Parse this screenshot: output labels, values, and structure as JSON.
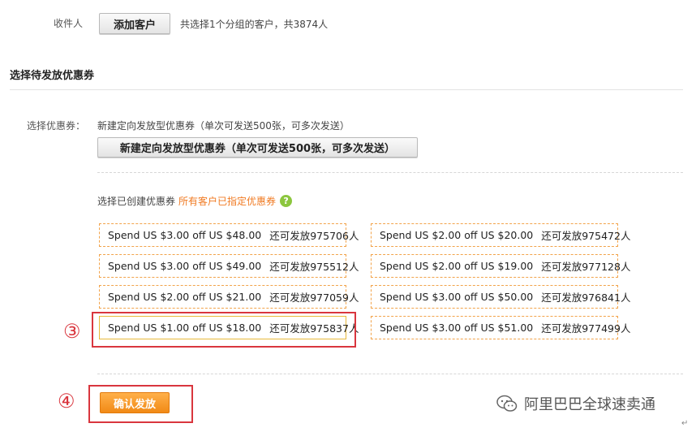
{
  "recipient": {
    "label": "收件人",
    "add_button": "添加客户",
    "summary": "共选择1个分组的客户，共3874人"
  },
  "section_title": "选择待发放优惠券",
  "coupon_select": {
    "label": "选择优惠券：",
    "new_description": "新建定向发放型优惠券（单次可发送500张，可多次发送）",
    "new_button": "新建定向发放型优惠券（单次可发送500张，可多次发送）",
    "existing_label": "选择已创建优惠券",
    "existing_link": "所有客户已指定优惠券",
    "help_glyph": "?"
  },
  "coupons_left": [
    {
      "text": "Spend US $3.00 off US $48.00",
      "remain": "还可发放975706人"
    },
    {
      "text": "Spend US $3.00 off US $49.00",
      "remain": "还可发放975512人"
    },
    {
      "text": "Spend US $2.00 off US $21.00",
      "remain": "还可发放977059人"
    },
    {
      "text": "Spend US $1.00 off US $18.00",
      "remain": "还可发放975837人"
    }
  ],
  "coupons_right": [
    {
      "text": "Spend US $2.00 off US $20.00",
      "remain": "还可发放975472人"
    },
    {
      "text": "Spend US $2.00 off US $19.00",
      "remain": "还可发放977128人"
    },
    {
      "text": "Spend US $3.00 off US $50.00",
      "remain": "还可发放976841人"
    },
    {
      "text": "Spend US $3.00 off US $51.00",
      "remain": "还可发放977499人"
    }
  ],
  "annotations": {
    "step3": "③",
    "step4": "④"
  },
  "confirm_button": "确认发放",
  "watermark": "阿里巴巴全球速卖通",
  "return_mark": "↵",
  "colors": {
    "accent_orange": "#f18a16",
    "link_orange": "#f07a22",
    "annotation_red": "#d9363e",
    "help_green": "#8cc63e"
  }
}
